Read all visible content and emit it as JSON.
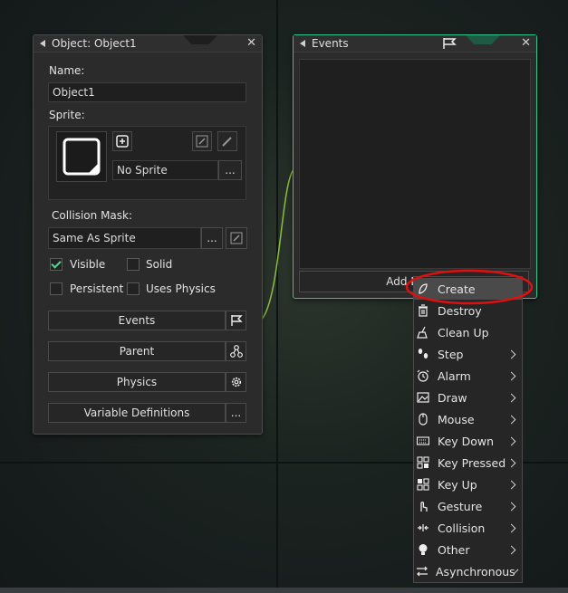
{
  "object_window": {
    "title": "Object: Object1",
    "name_label": "Name:",
    "name_value": "Object1",
    "sprite_label": "Sprite:",
    "sprite_value": "No Sprite",
    "collision_label": "Collision Mask:",
    "collision_value": "Same As Sprite",
    "ellipsis": "...",
    "checkboxes": [
      {
        "label": "Visible",
        "checked": true
      },
      {
        "label": "Solid",
        "checked": false
      },
      {
        "label": "Persistent",
        "checked": false
      },
      {
        "label": "Uses Physics",
        "checked": false
      }
    ],
    "buttons": [
      "Events",
      "Parent",
      "Physics",
      "Variable Definitions"
    ]
  },
  "events_window": {
    "title": "Events",
    "add_button": "Add Event",
    "accent": "#2ec58e"
  },
  "context_menu": {
    "items": [
      {
        "label": "Create",
        "icon": "create-icon",
        "submenu": false,
        "highlighted": true
      },
      {
        "label": "Destroy",
        "icon": "destroy-icon",
        "submenu": false
      },
      {
        "label": "Clean Up",
        "icon": "clean-up-icon",
        "submenu": false
      },
      {
        "label": "Step",
        "icon": "step-icon",
        "submenu": true
      },
      {
        "label": "Alarm",
        "icon": "alarm-icon",
        "submenu": true
      },
      {
        "label": "Draw",
        "icon": "draw-icon",
        "submenu": true
      },
      {
        "label": "Mouse",
        "icon": "mouse-icon",
        "submenu": true
      },
      {
        "label": "Key Down",
        "icon": "key-down-icon",
        "submenu": true
      },
      {
        "label": "Key Pressed",
        "icon": "key-pressed-icon",
        "submenu": true
      },
      {
        "label": "Key Up",
        "icon": "key-up-icon",
        "submenu": true
      },
      {
        "label": "Gesture",
        "icon": "gesture-icon",
        "submenu": true
      },
      {
        "label": "Collision",
        "icon": "collision-icon",
        "submenu": true
      },
      {
        "label": "Other",
        "icon": "other-icon",
        "submenu": true
      },
      {
        "label": "Asynchronous",
        "icon": "asynchronous-icon",
        "submenu": true
      }
    ],
    "annotation_color": "#e01010"
  }
}
